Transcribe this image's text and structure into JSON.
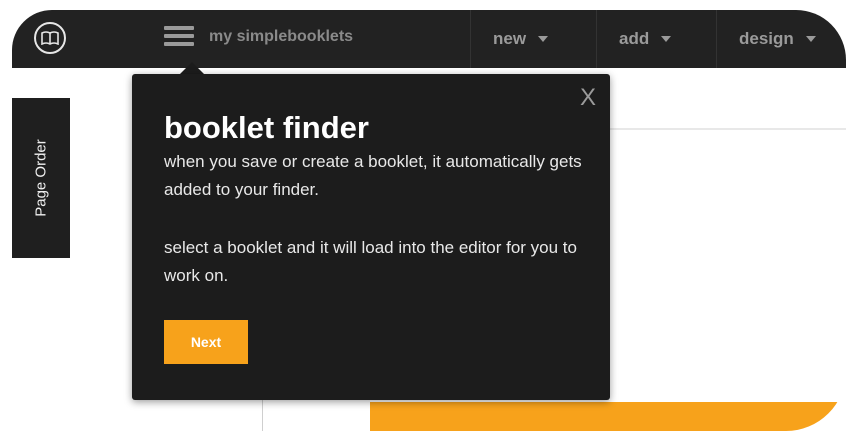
{
  "navbar": {
    "logo_icon": "book-icon",
    "brand": "my simplebooklets",
    "menu": [
      {
        "label": "new"
      },
      {
        "label": "add"
      },
      {
        "label": "design"
      }
    ]
  },
  "side_tab": {
    "label": "Page Order"
  },
  "popover": {
    "close": "X",
    "title": "booklet finder",
    "paragraph1": "when you save or create a booklet, it automatically gets added to your finder.",
    "paragraph2": "select a booklet and it will load into the editor for you to work on.",
    "next_label": "Next"
  },
  "colors": {
    "accent": "#f7a21b",
    "navbar": "#222222",
    "popover": "#1c1c1c"
  }
}
